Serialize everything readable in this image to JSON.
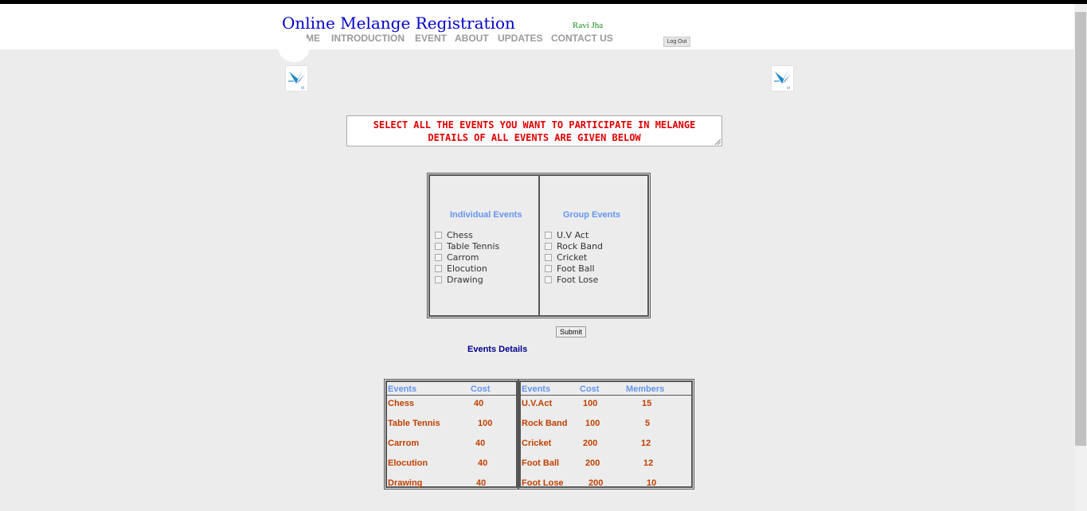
{
  "header": {
    "title": "Online Melange Registration",
    "user": "Ravi Jha",
    "nav": [
      "HOME",
      "INTRODUCTION",
      "EVENT",
      "ABOUT",
      "UPDATES",
      "CONTACT US"
    ],
    "logout": "Log Out"
  },
  "notice": {
    "line1": "SELECT ALL THE EVENTS YOU WANT TO PARTICIPATE IN MELANGE",
    "line2": "DETAILS OF ALL EVENTS ARE GIVEN BELOW"
  },
  "individual": {
    "heading": "Individual Events",
    "items": [
      "Chess",
      "Table Tennis",
      "Carrom",
      "Elocution",
      "Drawing"
    ]
  },
  "group": {
    "heading": "Group Events",
    "items": [
      "U.V Act",
      "Rock Band",
      "Cricket",
      "Foot Ball",
      "Foot Lose"
    ]
  },
  "submit": "Submit",
  "details_title": "Events Details",
  "individual_table": {
    "headers": [
      "Events",
      "Cost"
    ],
    "rows": [
      [
        "Chess",
        "40"
      ],
      [
        "Table Tennis",
        "100"
      ],
      [
        "Carrom",
        "40"
      ],
      [
        "Elocution",
        "40"
      ],
      [
        "Drawing",
        "40"
      ]
    ]
  },
  "group_table": {
    "headers": [
      "Events",
      "Cost",
      "Members"
    ],
    "rows": [
      [
        "U.V.Act",
        "100",
        "15"
      ],
      [
        "Rock Band",
        "100",
        "5"
      ],
      [
        "Cricket",
        "200",
        "12"
      ],
      [
        "Foot Ball",
        "200",
        "12"
      ],
      [
        "Foot Lose",
        "200",
        "10"
      ]
    ]
  }
}
